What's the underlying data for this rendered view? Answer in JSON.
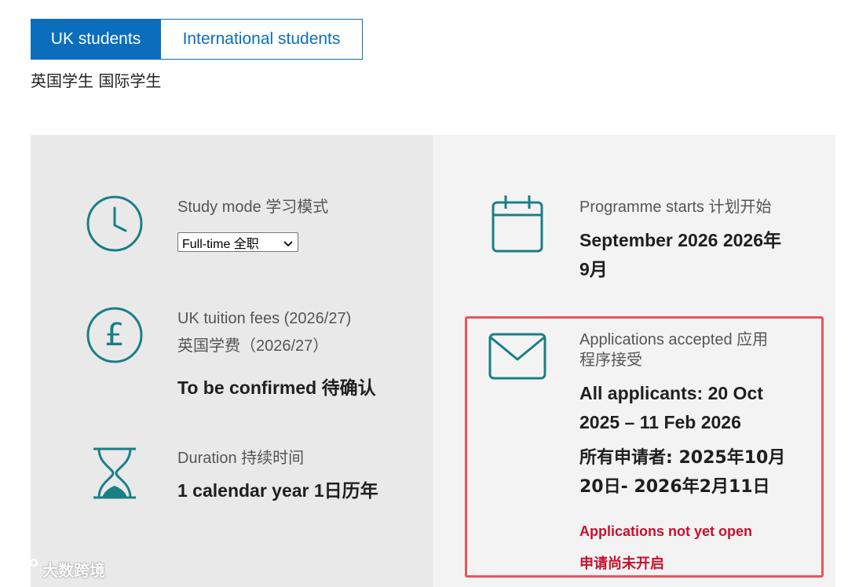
{
  "tabs": {
    "uk_label": "UK students",
    "intl_label": "International students",
    "caption": "英国学生 国际学生"
  },
  "study_mode": {
    "label": "Study mode 学习模式",
    "selected": "Full-time 全职",
    "icon": "clock-icon"
  },
  "fees": {
    "label_line1": "UK tuition fees (2026/27)",
    "label_line2": "英国学费（2026/27）",
    "value": "To be confirmed 待确认",
    "icon": "pound-icon"
  },
  "duration": {
    "label": "Duration 持续时间",
    "value": "1 calendar year 1日历年",
    "icon": "hourglass-icon"
  },
  "programme_starts": {
    "label": "Programme starts 计划开始",
    "value_line1": "September 2026 2026年",
    "value_line2": "9月",
    "icon": "calendar-icon"
  },
  "applications": {
    "label_line1": "Applications accepted 应用",
    "label_line2": "程序接受",
    "value_line1": "All applicants: 20 Oct",
    "value_line2": "2025 – 11 Feb 2026",
    "value_cn_line1": "所有申请者: 2025年10月",
    "value_cn_line2": "20日- 2026年2月11日",
    "status_en": "Applications not yet open",
    "status_cn": "申请尚未开启",
    "icon": "envelope-icon"
  },
  "watermark": {
    "text": "大数跨境"
  },
  "colors": {
    "accent": "#0a6ebd",
    "icon_teal": "#1a7f86",
    "highlight": "#e85558",
    "status_red": "#c8102e"
  }
}
